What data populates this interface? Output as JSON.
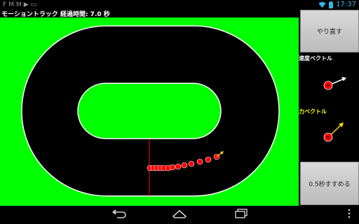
{
  "status_bar": {
    "icons": [
      "F",
      "M",
      "M",
      "▶",
      "▭"
    ],
    "time": "17:37",
    "signal_icon": "wifi-icon",
    "battery_icon": "battery-icon"
  },
  "app": {
    "title": "モーショントラック 経過時間: 7.0 秒"
  },
  "side_panel": {
    "redo_button": "やり直す",
    "velocity_label": "速度ベクトル",
    "force_label": "力ベクトル",
    "advance_button": "0.5秒すすめる"
  },
  "colors": {
    "field_green": "#00ff00",
    "track_black": "#000000",
    "track_line": "#ffffff",
    "start_line": "#ff0000",
    "ball_red": "#ff0000",
    "velocity_label_color": "#ffffff",
    "force_label_color": "#ffff00",
    "force_arrow": "#ffd700"
  },
  "nav_bar": {
    "back_icon": "back-icon",
    "home_icon": "home-icon",
    "recents_icon": "recent-apps-icon",
    "menu_icon": "overflow-menu-icon"
  }
}
